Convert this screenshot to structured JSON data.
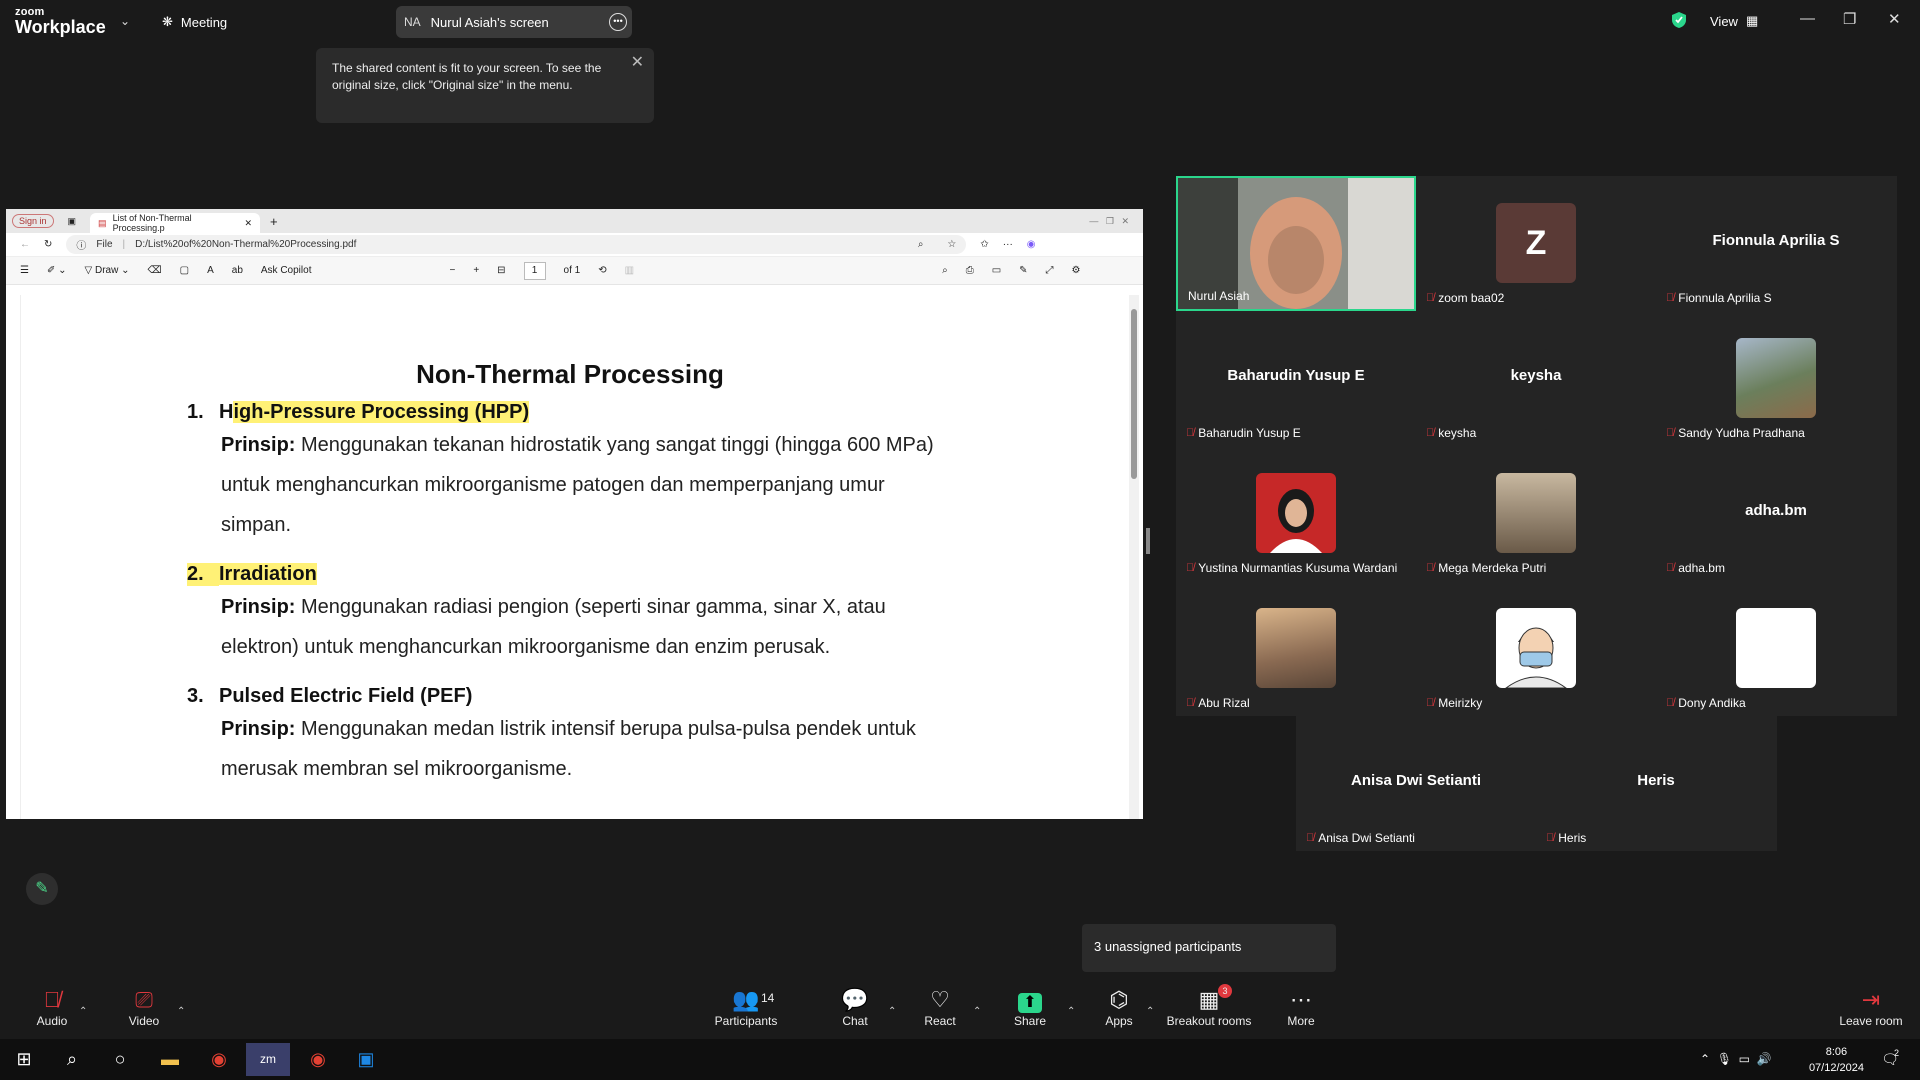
{
  "app": {
    "logo_line1": "zoom",
    "logo_line2": "Workplace",
    "meeting_label": "Meeting"
  },
  "share_pill": {
    "initials": "NA",
    "label": "Nurul Asiah's screen"
  },
  "tooltip": {
    "text": "The shared content is fit to your screen. To see the original size, click \"Original size\" in the menu."
  },
  "view_label": "View",
  "browser": {
    "signin": "Sign in",
    "tab_title": "List of Non-Thermal Processing.p",
    "file_label": "File",
    "address": "D:/List%20of%20Non-Thermal%20Processing.pdf",
    "draw_label": "Draw",
    "copilot_label": "Ask Copilot",
    "page_current": "1",
    "page_total": "of 1"
  },
  "document": {
    "title": "Non-Thermal Processing",
    "items": [
      {
        "num": "1.",
        "heading_first": "H",
        "heading_rest": "igh-Pressure Processing (HPP)",
        "lines": [
          "Prinsip:",
          " Menggunakan tekanan hidrostatik yang sangat tinggi (hingga 600 MPa)",
          "untuk menghancurkan mikroorganisme patogen dan memperpanjang umur",
          "simpan."
        ]
      },
      {
        "num": "2.",
        "heading": "Irradiation",
        "lines": [
          "Prinsip:",
          " Menggunakan radiasi pengion (seperti sinar gamma, sinar X, atau",
          "elektron) untuk menghancurkan mikroorganisme dan enzim perusak."
        ]
      },
      {
        "num": "3.",
        "heading": "Pulsed Electric Field (PEF)",
        "lines": [
          "Prinsip:",
          " Menggunakan medan listrik intensif berupa pulsa-pulsa pendek untuk",
          "merusak membran sel mikroorganisme."
        ]
      }
    ]
  },
  "participants": [
    {
      "name": "Nurul Asiah",
      "display": "",
      "kind": "video"
    },
    {
      "name": "zoom baa02",
      "display": "Z",
      "kind": "letter"
    },
    {
      "name": "Fionnula Aprilia S",
      "display": "Fionnula Aprilia S",
      "kind": "text"
    },
    {
      "name": "Baharudin Yusup E",
      "display": "Baharudin Yusup E",
      "kind": "text"
    },
    {
      "name": "keysha",
      "display": "keysha",
      "kind": "text"
    },
    {
      "name": "Sandy Yudha Pradhana",
      "display": "",
      "kind": "photo"
    },
    {
      "name": "Yustina Nurmantias Kusuma Wardani",
      "display": "",
      "kind": "photo"
    },
    {
      "name": "Mega Merdeka Putri",
      "display": "",
      "kind": "photo"
    },
    {
      "name": "adha.bm",
      "display": "adha.bm",
      "kind": "text"
    },
    {
      "name": "Abu Rizal",
      "display": "",
      "kind": "photo"
    },
    {
      "name": "Meirizky",
      "display": "",
      "kind": "photo"
    },
    {
      "name": "Dony Andika",
      "display": "",
      "kind": "blank"
    },
    {
      "name": "Anisa Dwi Setianti",
      "display": "Anisa Dwi Setianti",
      "kind": "text"
    },
    {
      "name": "Heris",
      "display": "Heris",
      "kind": "text"
    }
  ],
  "unassigned": "3 unassigned participants",
  "toolbar": {
    "audio": "Audio",
    "video": "Video",
    "participants": "Participants",
    "participants_count": "14",
    "chat": "Chat",
    "react": "React",
    "share": "Share",
    "apps": "Apps",
    "breakout": "Breakout rooms",
    "breakout_badge": "3",
    "more": "More",
    "leave": "Leave room"
  },
  "clock": {
    "time": "8:06",
    "date": "07/12/2024"
  },
  "notif_count": "2",
  "colors": {
    "accent_green": "#2bd68c",
    "mute_red": "#e0383e",
    "highlight": "#fff176"
  }
}
